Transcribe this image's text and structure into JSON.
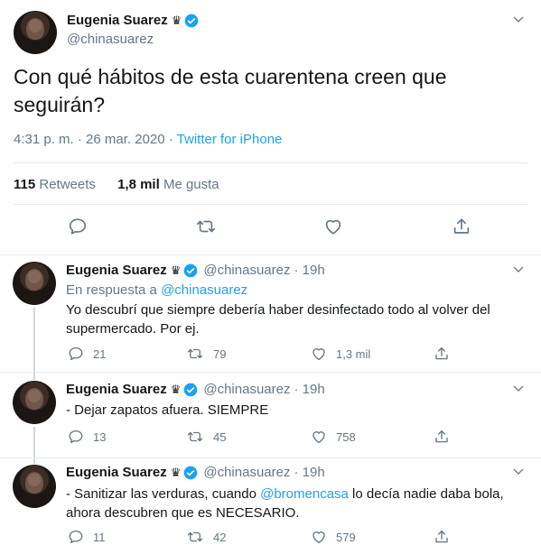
{
  "main_tweet": {
    "name": "Eugenia Suarez",
    "crown": "♛",
    "handle": "@chinasuarez",
    "text": "Con qué hábitos de esta cuarentena creen que seguirán?",
    "time": "4:31 p. m. · 26 mar. 2020",
    "separator": " · ",
    "source": "Twitter for iPhone",
    "retweets_count": "115",
    "retweets_label": "Retweets",
    "likes_count": "1,8 mil",
    "likes_label": "Me gusta",
    "icons": [
      "reply-icon",
      "retweet-icon",
      "like-icon",
      "share-icon"
    ]
  },
  "replies": [
    {
      "name": "Eugenia Suarez",
      "crown": "♛",
      "handle": "@chinasuarez",
      "time": "· 19h",
      "in_reply_prefix": "En respuesta a",
      "in_reply_handle": "@chinasuarez",
      "text": "Yo descubrí que siempre debería haber desinfectado todo al volver del supermercado. Por ej.",
      "replies": "21",
      "retweets": "79",
      "likes": "1,3 mil"
    },
    {
      "name": "Eugenia Suarez",
      "crown": "♛",
      "handle": "@chinasuarez",
      "time": "· 19h",
      "text": "- Dejar zapatos afuera. SIEMPRE",
      "replies": "13",
      "retweets": "45",
      "likes": "758"
    },
    {
      "name": "Eugenia Suarez",
      "crown": "♛",
      "handle": "@chinasuarez",
      "time": "· 19h",
      "text_before": "- Sanitizar las verduras, cuando ",
      "mention": "@bromencasa",
      "text_after": " lo decía nadie daba bola, ahora descubren que es NECESARIO.",
      "replies": "11",
      "retweets": "42",
      "likes": "579"
    }
  ],
  "colors": {
    "accent": "#1da1f2",
    "secondary_text": "#657786",
    "primary_text": "#14171a",
    "divider": "#e6ecf0"
  }
}
